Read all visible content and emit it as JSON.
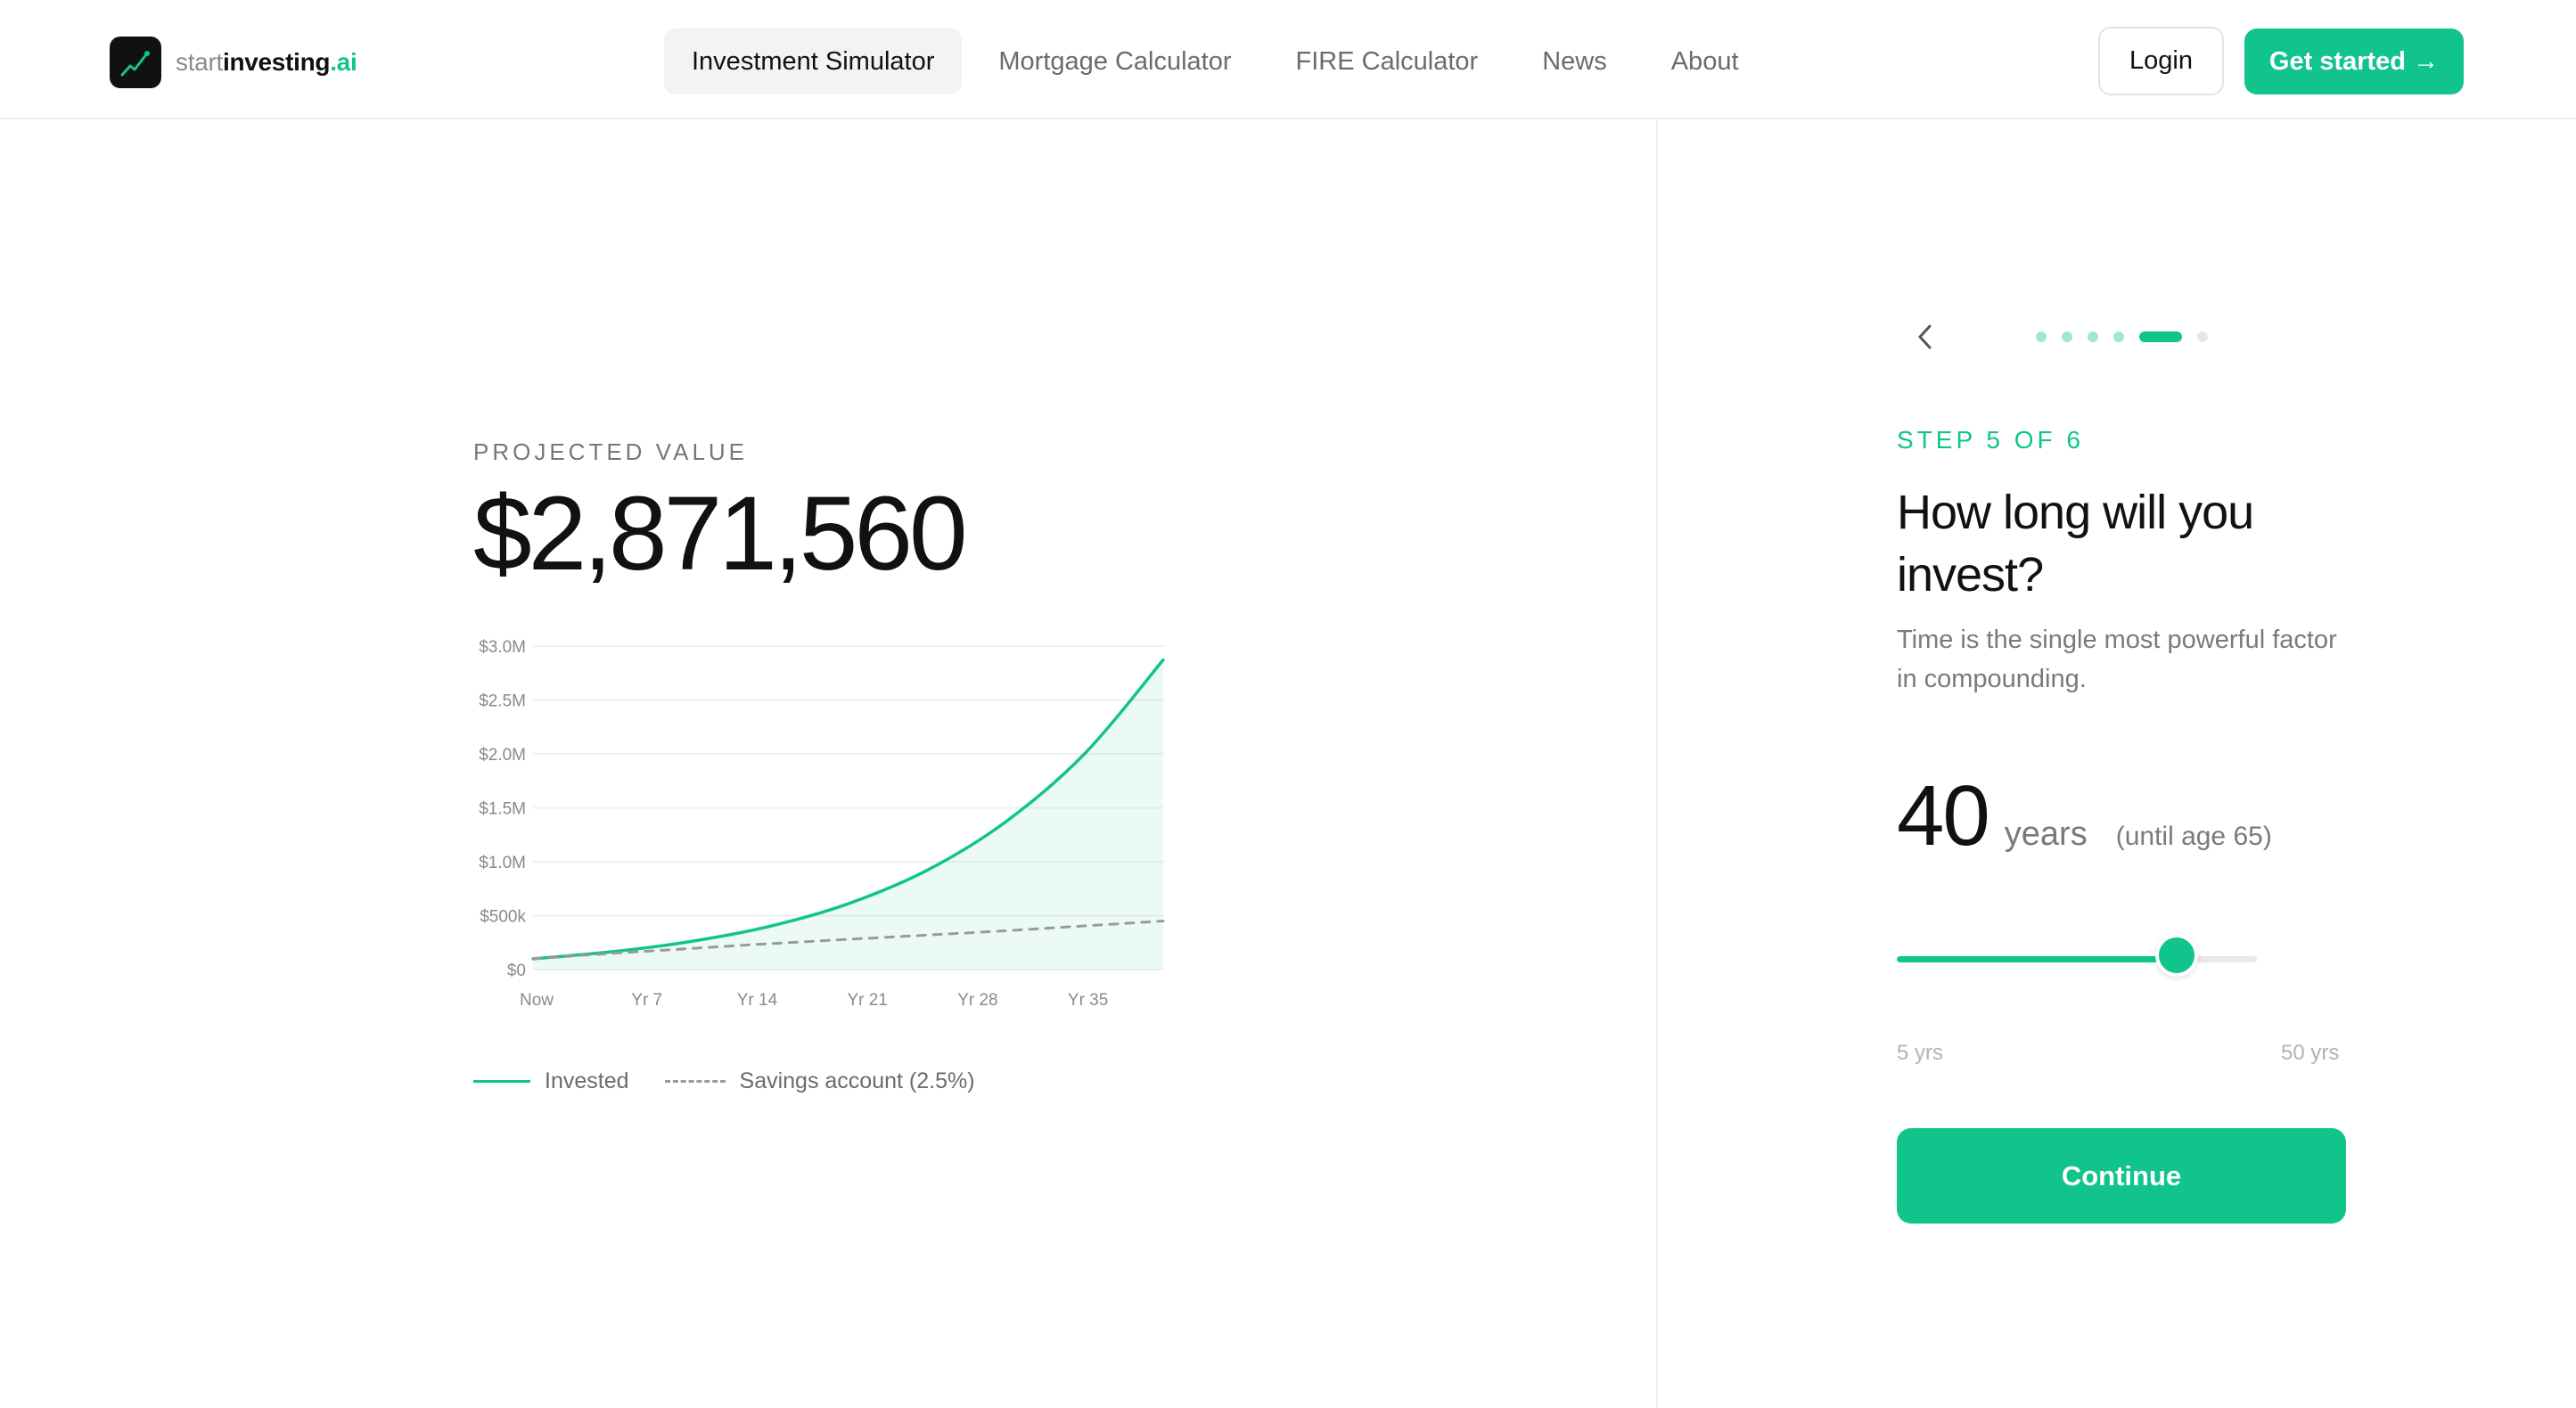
{
  "header": {
    "logo": {
      "part1": "start",
      "part2": "investing",
      "part3": ".ai",
      "icon": "trend-up-icon"
    },
    "nav": [
      {
        "label": "Investment Simulator",
        "active": true
      },
      {
        "label": "Mortgage Calculator",
        "active": false
      },
      {
        "label": "FIRE Calculator",
        "active": false
      },
      {
        "label": "News",
        "active": false
      },
      {
        "label": "About",
        "active": false
      }
    ],
    "login_label": "Login",
    "get_started_label": "Get started →"
  },
  "summary": {
    "label": "PROJECTED VALUE",
    "value": "$2,871,560"
  },
  "chart_data": {
    "type": "line",
    "x": [
      0,
      5,
      10,
      15,
      20,
      25,
      30,
      35,
      40
    ],
    "x_tick_values": [
      0,
      7,
      14,
      21,
      28,
      35
    ],
    "x_tick_labels": [
      "Now",
      "Yr 7",
      "Yr 14",
      "Yr 21",
      "Yr 28",
      "Yr 35"
    ],
    "y_tick_values": [
      0,
      500000,
      1000000,
      1500000,
      2000000,
      2500000,
      3000000
    ],
    "y_tick_labels": [
      "$0",
      "$500k",
      "$1.0M",
      "$1.5M",
      "$2.0M",
      "$2.5M",
      "$3.0M"
    ],
    "ylim": [
      0,
      3000000
    ],
    "xlim": [
      0,
      40
    ],
    "series": [
      {
        "name": "Invested",
        "style": "solid",
        "color": "#10c48c",
        "area": true,
        "values": [
          100000,
          165000,
          260000,
          400000,
          610000,
          920000,
          1370000,
          2000000,
          2871560
        ]
      },
      {
        "name": "Savings account (2.5%)",
        "style": "dashed",
        "color": "#9a9a9a",
        "area": false,
        "values": [
          100000,
          150000,
          195000,
          240000,
          280000,
          320000,
          360000,
          405000,
          450000
        ]
      }
    ],
    "grid": true,
    "legend_position": "bottom-left"
  },
  "wizard": {
    "back_icon": "chevron-left-icon",
    "steps_total": 6,
    "current_step": 5,
    "step_label": "STEP 5 OF 6",
    "question": "How long will you invest?",
    "subtext": "Time is the single most powerful factor in compounding.",
    "years_value": "40",
    "years_unit": "years",
    "years_note": "(until age 65)",
    "slider": {
      "min": 5,
      "max": 50,
      "value": 40
    },
    "range_min_label": "5 yrs",
    "range_max_label": "50 yrs",
    "continue_label": "Continue"
  },
  "colors": {
    "accent": "#10c48c",
    "muted": "#7a7a7a",
    "text": "#111111"
  }
}
